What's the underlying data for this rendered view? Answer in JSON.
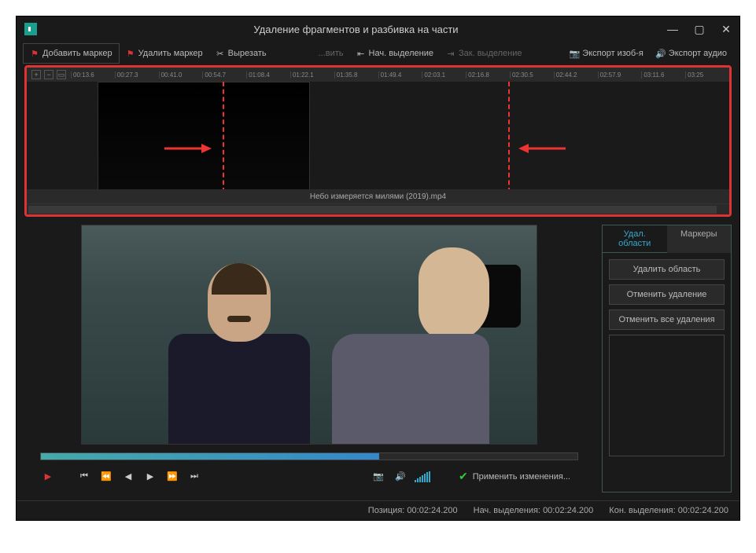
{
  "titlebar": {
    "title": "Удаление фрагментов и разбивка на части"
  },
  "toolbar": {
    "add_marker": "Добавить маркер",
    "del_marker": "Удалить маркер",
    "cut": "Вырезать",
    "restore": "...вить",
    "sel_start": "Нач. выделение",
    "sel_end": "Зак. выделение",
    "export_img": "Экспорт изоб-я",
    "export_audio": "Экспорт аудио"
  },
  "timeline": {
    "ticks": [
      "00:13.6",
      "00:27.3",
      "00:41.0",
      "00:54.7",
      "01:08.4",
      "01:22.1",
      "01:35.8",
      "01:49.4",
      "02:03.1",
      "02:16.8",
      "02:30.5",
      "02:44.2",
      "02:57.9",
      "03:11.6",
      "03:25"
    ],
    "filename": "Небо измеряется милями (2019).mp4"
  },
  "side": {
    "tab_areas": "Удал. области",
    "tab_markers": "Маркеры",
    "btn_delete": "Удалить область",
    "btn_undo": "Отменить удаление",
    "btn_undo_all": "Отменить все удаления"
  },
  "apply": {
    "label": "Применить изменения..."
  },
  "status": {
    "pos_label": "Позиция:",
    "pos_val": "00:02:24.200",
    "start_label": "Нач. выделения:",
    "start_val": "00:02:24.200",
    "end_label": "Кон. выделения:",
    "end_val": "00:02:24.200"
  },
  "colors": {
    "accent": "#3ac",
    "highlight": "#d33"
  }
}
